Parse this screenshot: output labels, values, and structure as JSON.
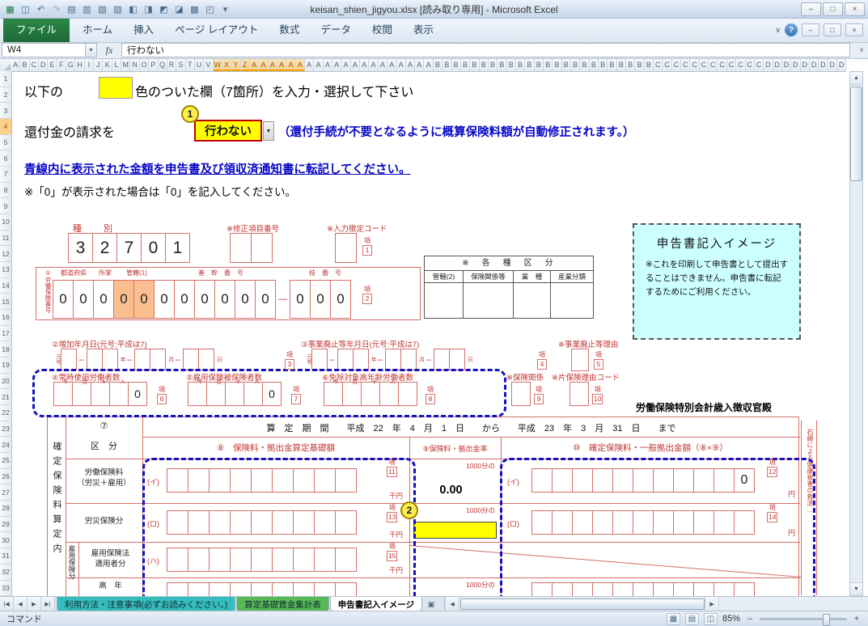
{
  "window": {
    "title": "keisan_shien_jigyou.xlsx  [読み取り専用]  -  Microsoft Excel",
    "min": "–",
    "max": "□",
    "close": "×",
    "collapse": "∨",
    "help": "?"
  },
  "qat": [
    {
      "name": "excel-logo",
      "glyph": "▦",
      "color": "#1c7a44"
    },
    {
      "name": "save",
      "glyph": "◫",
      "color": "#3a6ea5"
    },
    {
      "name": "undo",
      "glyph": "↶",
      "color": "#3a6ea5"
    },
    {
      "name": "redo",
      "glyph": "↷",
      "color": "#9aa8b8"
    },
    {
      "name": "qat-custom-1",
      "glyph": "▤",
      "color": "#4a6a8a"
    },
    {
      "name": "qat-custom-2",
      "glyph": "▥",
      "color": "#4a6a8a"
    },
    {
      "name": "qat-custom-3",
      "glyph": "▧",
      "color": "#4a6a8a"
    },
    {
      "name": "qat-custom-4",
      "glyph": "▨",
      "color": "#4a6a8a"
    },
    {
      "name": "qat-custom-5",
      "glyph": "◧",
      "color": "#4a6a8a"
    },
    {
      "name": "qat-custom-6",
      "glyph": "◨",
      "color": "#4a6a8a"
    },
    {
      "name": "qat-custom-7",
      "glyph": "◩",
      "color": "#4a6a8a"
    },
    {
      "name": "qat-custom-8",
      "glyph": "◪",
      "color": "#4a6a8a"
    },
    {
      "name": "qat-custom-9",
      "glyph": "▩",
      "color": "#4a6a8a"
    },
    {
      "name": "qat-custom-10",
      "glyph": "◰",
      "color": "#4a6a8a"
    },
    {
      "name": "qat-dropdown",
      "glyph": "▾",
      "color": "#4a6a8a"
    }
  ],
  "ribbon": {
    "file": "ファイル",
    "tabs": [
      "ホーム",
      "挿入",
      "ページ レイアウト",
      "数式",
      "データ",
      "校閲",
      "表示"
    ]
  },
  "formula": {
    "cell": "W4",
    "fx": "fx",
    "value": "行わない",
    "namedrop": "▼",
    "expand": "∨"
  },
  "grid": {
    "columns": "ABCDEFGHIJKLMNOPQRSTUVWXYZAAAAAAAAAAAAAAAAAAAABBBBBBBBBBBBBBBBBBBBBBBBCCCCCCCCCCCCDDDDDDDDD",
    "sel_start": 22,
    "sel_end": 32,
    "row_count": 33,
    "selected_row": 4
  },
  "sheet": {
    "instr_pre": "以下の",
    "instr_post": "色のついた欄（7箇所）を入力・選択して下さい",
    "refund_label": "還付金の請求を",
    "badge1": "1",
    "badge2": "2",
    "refund_value": "行わない",
    "dd_arrow": "▼",
    "refund_note": "（還付手続が不要となるように概算保険料額が自動修正されます。）",
    "blue_note": "青線内に表示された金額を申告書及び領収済通知書に転記してください。",
    "zero_note": "※「0」が表示された場合は「0」を記入してください。",
    "shubetsu_label": "種　別",
    "fix_label": "※修正項目番号",
    "code_label": "※入力徴定コード",
    "rouhoken_vlabel": "①労働保険番号",
    "rouhoken_headers": [
      {
        "t": "都道府県",
        "w": 52
      },
      {
        "t": "所掌",
        "w": 26
      },
      {
        "t": "管轄(1)",
        "w": 52
      },
      {
        "t": "基　幹　番　号",
        "w": 156
      },
      {
        "t": "",
        "w": 12
      },
      {
        "t": "枝　番　号",
        "w": 78
      }
    ],
    "kakushu_title": "※　各　種　区　分",
    "kakushu_headers": [
      "管轄(2)",
      "保険関係等",
      "業　種",
      "産業分類"
    ],
    "image_title": "申告書記入イメージ",
    "image_body": "※これを印刷して申告書として提出することはできません。申告書に転記するためにご利用ください。",
    "label2": "②増加年月日(元号:平成は7)",
    "label3": "③事業廃止等年月日(元号:平成は7)",
    "label_rh": "※事業廃止等理由",
    "date_units": [
      "元号",
      "年",
      "月",
      "日"
    ],
    "label4": "④常時使用労働者数",
    "label5": "⑤雇用保険被保険者数",
    "label6": "⑥免除対象高年齢労働者数",
    "unit_marks": "千百十人",
    "label_hk": "※保険関係",
    "label_kh": "※片保険理由コード",
    "tokubetsu": "労働保険特別会計歳入徴収官殿",
    "asbestos": "石綿による健康被害の救済…",
    "ko_label": "項",
    "kon": {
      "n1": "1",
      "n2": "2",
      "n3": "3",
      "n4": "4",
      "n5": "5",
      "n6": "6",
      "n7": "7",
      "n8": "8",
      "n9": "9",
      "n10": "10",
      "n11": "11",
      "n12": "12",
      "n13": "13",
      "n14": "14",
      "n15": "15"
    },
    "boxes": {
      "shubetsu": [
        "3",
        "2",
        "7",
        "0",
        "1"
      ],
      "fix": [
        "",
        ""
      ],
      "code": [
        ""
      ],
      "rouhoken": [
        "0",
        "0",
        "0",
        {
          "v": "0",
          "hl": true
        },
        {
          "v": "0",
          "hl": true
        },
        "0",
        "0",
        "0",
        "0",
        "0",
        "0",
        "—",
        "0",
        "0",
        "0"
      ],
      "workers": [
        "",
        "",
        "",
        "",
        "0"
      ],
      "insured": [
        "",
        "",
        "",
        "",
        "0"
      ],
      "exempt": [
        "",
        "",
        "",
        "",
        ""
      ],
      "hk": [
        ""
      ],
      "kh": [
        ""
      ],
      "rhreason": [
        ""
      ],
      "e9": [
        "",
        "",
        "",
        "",
        "",
        "",
        "",
        "",
        ""
      ],
      "c10r1": [
        "",
        "",
        "",
        "",
        "",
        "",
        "",
        "",
        "",
        "",
        "0"
      ],
      "e11": [
        "",
        "",
        "",
        "",
        "",
        "",
        "",
        "",
        "",
        "",
        ""
      ]
    }
  },
  "table": {
    "col_a": "確定保険料算定内",
    "col7_mark": "⑦",
    "col7_label": "区　分",
    "period": "算　定　期　間　　平成　22　年　4　月　1　日　　から　　平成　23　年　3　月　31　日　　まで",
    "col8": "⑧　保険料・拠出金算定基礎額",
    "col9": "⑨保険料・拠出金率",
    "col10": "⑩　確定保険料・一般拠出金額（⑧×⑨）",
    "r1_label": "労働保険料\n（労災＋雇用）",
    "r2_label": "労災保険分",
    "r3_label": "雇用保険法\n適用者分",
    "r4_label": "高　年",
    "strip_label": "雇用保険分",
    "paren1": "(イ)",
    "paren2": "(ロ)",
    "paren3": "(ハ)",
    "senyen": "千円",
    "yen": "円",
    "bun": "1000分の",
    "rate1": "0.00"
  },
  "sheets": [
    {
      "label": "利用方法・注意事項(必ずお読みください。)",
      "color": "#35bcbc",
      "active": false
    },
    {
      "label": "算定基礎賃金集計表",
      "color": "#56b956",
      "active": false
    },
    {
      "label": "申告書記入イメージ",
      "color": "#ffffff",
      "active": true
    }
  ],
  "chrome": {
    "tab_nav": [
      "|◀",
      "◀",
      "▶",
      "▶|"
    ],
    "view_icons": [
      {
        "name": "normal-view",
        "glyph": "▦"
      },
      {
        "name": "page-layout-view",
        "glyph": "▤"
      },
      {
        "name": "page-break-view",
        "glyph": "◫"
      }
    ]
  },
  "status": {
    "left": "コマンド",
    "zoom": "85%",
    "minus": "–",
    "plus": "+"
  }
}
